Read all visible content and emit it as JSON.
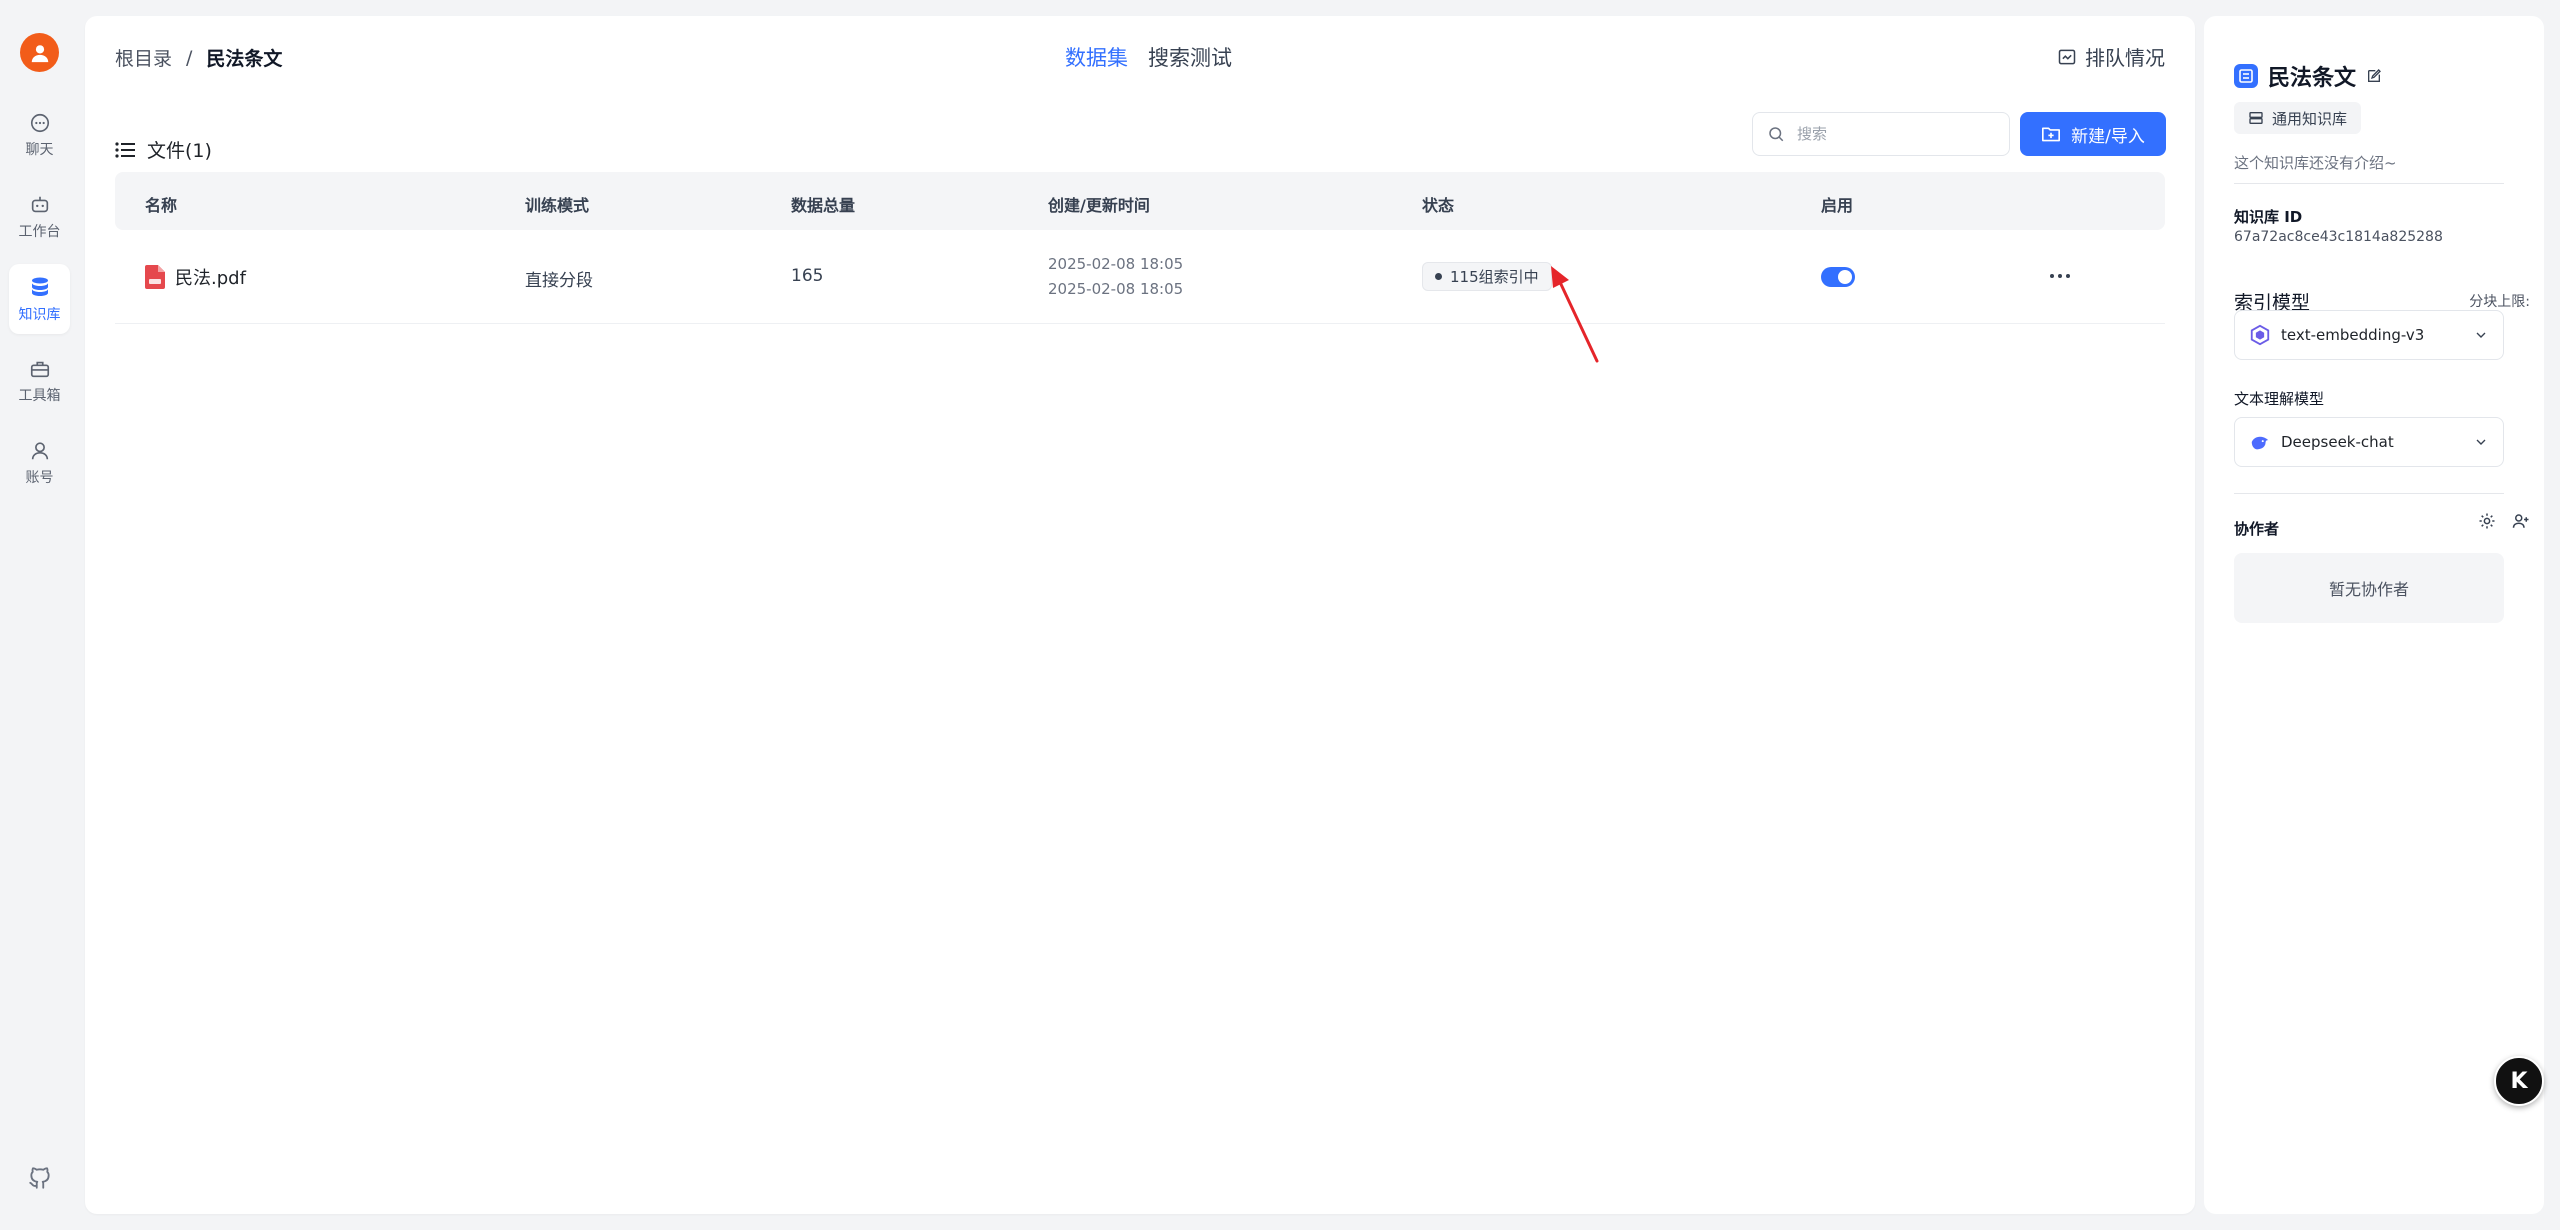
{
  "nav": {
    "items": [
      {
        "label": "聊天",
        "icon": "chat-icon"
      },
      {
        "label": "工作台",
        "icon": "robot-icon"
      },
      {
        "label": "知识库",
        "icon": "database-icon",
        "active": true
      },
      {
        "label": "工具箱",
        "icon": "toolbox-icon"
      },
      {
        "label": "账号",
        "icon": "user-icon"
      }
    ]
  },
  "header": {
    "breadcrumb": {
      "root": "根目录",
      "separator": "/",
      "current": "民法条文"
    },
    "tabs": [
      {
        "label": "数据集",
        "active": true
      },
      {
        "label": "搜索测试"
      }
    ],
    "queue_label": "排队情况"
  },
  "files": {
    "title": "文件(1)",
    "search_placeholder": "搜索",
    "new_button": "新建/导入",
    "columns": [
      "名称",
      "训练模式",
      "数据总量",
      "创建/更新时间",
      "状态",
      "启用"
    ],
    "rows": [
      {
        "name": "民法.pdf",
        "mode": "直接分段",
        "count": "165",
        "created": "2025-02-08 18:05",
        "updated": "2025-02-08 18:05",
        "status": "115组索引中",
        "enabled": true
      }
    ]
  },
  "side": {
    "title": "民法条文",
    "type_label": "通用知识库",
    "intro": "这个知识库还没有介绍~",
    "id_label": "知识库 ID",
    "id_value": "67a72ac8ce43c1814a825288",
    "index_model_label": "索引模型",
    "chunk_limit_label": "分块上限:",
    "index_model": "text-embedding-v3",
    "text_model_label": "文本理解模型",
    "text_model": "Deepseek-chat",
    "collab_label": "协作者",
    "collab_empty": "暂无协作者"
  },
  "colors": {
    "accent": "#3370ff",
    "avatar": "#f25c19",
    "annotation": "#e5252a"
  }
}
